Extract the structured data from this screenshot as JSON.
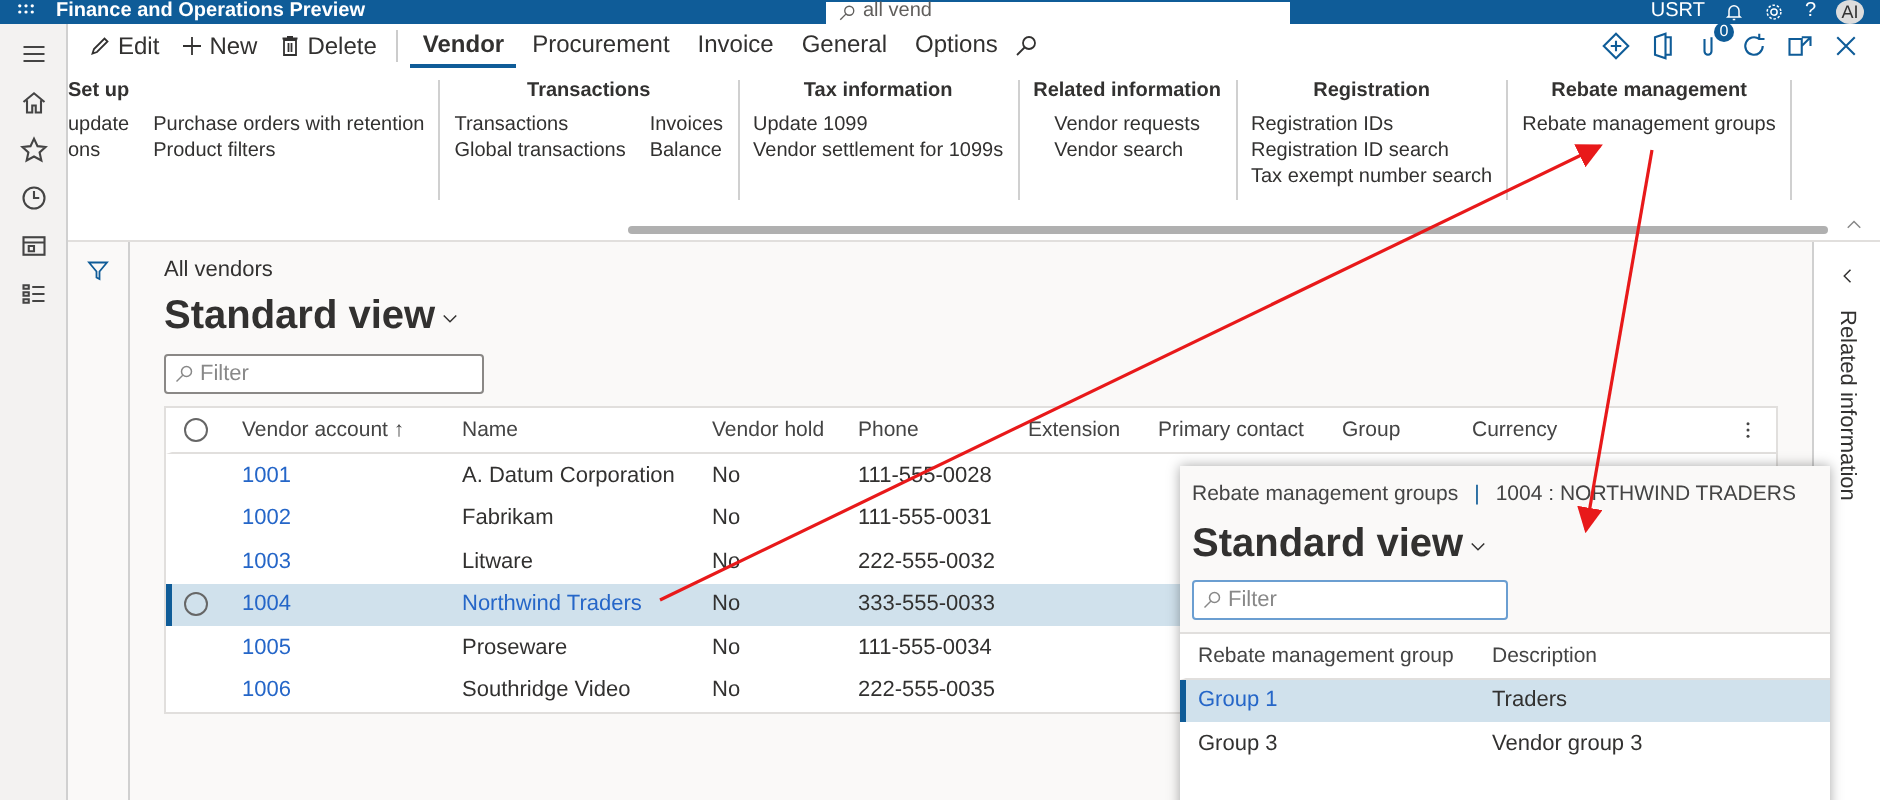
{
  "top_bar": {
    "title": "Finance and Operations Preview",
    "search_value": "all vend",
    "company": "USRT",
    "help": "?",
    "avatar": "AI"
  },
  "toolbar": {
    "actions": [
      {
        "kind": "edit",
        "label": "Edit"
      },
      {
        "kind": "new",
        "label": "New"
      },
      {
        "kind": "delete",
        "label": "Delete"
      }
    ],
    "tabs": [
      {
        "label": "Vendor",
        "selected": true
      },
      {
        "label": "Procurement",
        "selected": false
      },
      {
        "label": "Invoice",
        "selected": false
      },
      {
        "label": "General",
        "selected": false
      },
      {
        "label": "Options",
        "selected": false
      }
    ],
    "notification_count": "0"
  },
  "ribbon": [
    {
      "title": "Set up",
      "columns": [
        [
          "update",
          "ons"
        ],
        [
          "Purchase orders with retention",
          "Product filters"
        ]
      ]
    },
    {
      "title": "Transactions",
      "columns": [
        [
          "Transactions",
          "Global transactions"
        ],
        [
          "Invoices",
          "Balance"
        ]
      ]
    },
    {
      "title": "Tax information",
      "columns": [
        [
          "Update 1099",
          "Vendor settlement for 1099s"
        ]
      ]
    },
    {
      "title": "Related information",
      "columns": [
        [
          "Vendor requests",
          "Vendor search"
        ]
      ]
    },
    {
      "title": "Registration",
      "columns": [
        [
          "Registration IDs",
          "Registration ID search",
          "Tax exempt number search"
        ]
      ]
    },
    {
      "title": "Rebate management",
      "columns": [
        [
          "Rebate management groups"
        ]
      ]
    }
  ],
  "page": {
    "breadcrumb": "All vendors",
    "view": "Standard view",
    "filter_placeholder": "Filter",
    "table": {
      "columns": [
        "Vendor account",
        "Name",
        "Vendor hold",
        "Phone",
        "Extension",
        "Primary contact",
        "Group",
        "Currency"
      ],
      "sort_indicator": "↑",
      "all_selected": false,
      "rows": [
        {
          "account": "1001",
          "name": "A. Datum Corporation",
          "hold": "No",
          "phone": "111-555-0028",
          "selected": false
        },
        {
          "account": "1002",
          "name": "Fabrikam",
          "hold": "No",
          "phone": "111-555-0031",
          "selected": false
        },
        {
          "account": "1003",
          "name": "Litware",
          "hold": "No",
          "phone": "222-555-0032",
          "selected": false
        },
        {
          "account": "1004",
          "name": "Northwind Traders",
          "hold": "No",
          "phone": "333-555-0033",
          "selected": true
        },
        {
          "account": "1005",
          "name": "Proseware",
          "hold": "No",
          "phone": "111-555-0034",
          "selected": false
        },
        {
          "account": "1006",
          "name": "Southridge Video",
          "hold": "No",
          "phone": "222-555-0035",
          "selected": false
        }
      ]
    }
  },
  "related_panel": {
    "title": "Related information"
  },
  "dialog": {
    "breadcrumb": "Rebate management groups",
    "separator": "|",
    "record": "1004 : NORTHWIND TRADERS",
    "view": "Standard view",
    "filter_placeholder": "Filter",
    "columns": [
      "Rebate management group",
      "Description"
    ],
    "rows": [
      {
        "group": "Group 1",
        "description": "Traders",
        "selected": true
      },
      {
        "group": "Group 3",
        "description": "Vendor group 3",
        "selected": false
      }
    ]
  }
}
